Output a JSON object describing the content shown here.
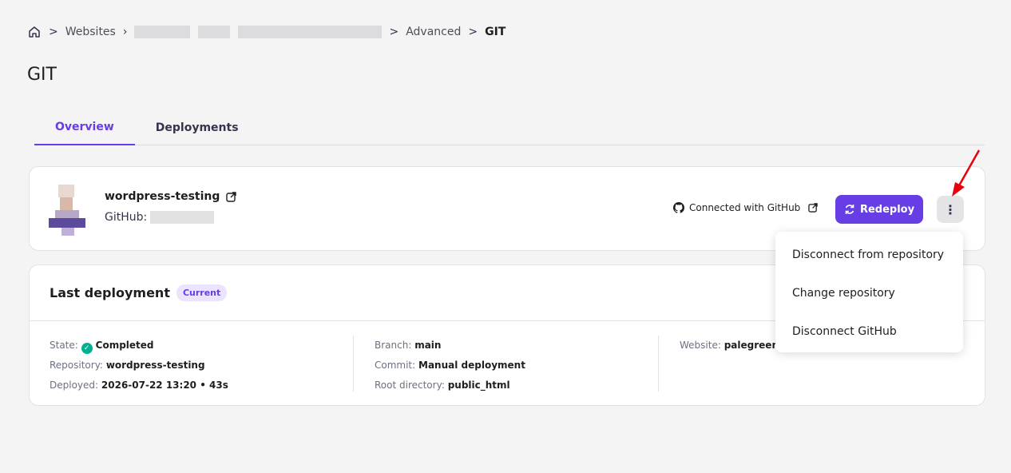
{
  "breadcrumb": {
    "home_icon": "home-icon",
    "websites": "Websites",
    "advanced": "Advanced",
    "current": "GIT"
  },
  "page": {
    "title": "GIT"
  },
  "tabs": [
    {
      "label": "Overview",
      "active": true
    },
    {
      "label": "Deployments",
      "active": false
    }
  ],
  "repo": {
    "name": "wordpress-testing",
    "github_prefix": "GitHub:",
    "connected_label": "Connected with GitHub",
    "redeploy_label": "Redeploy",
    "more_icon": "⋮"
  },
  "menu": {
    "items": [
      "Disconnect from repository",
      "Change repository",
      "Disconnect GitHub"
    ]
  },
  "deployment": {
    "title": "Last deployment",
    "badge": "Current",
    "state_label": "State:",
    "state_value": "Completed",
    "repository_label": "Repository:",
    "repository_value": "wordpress-testing",
    "deployed_label": "Deployed:",
    "deployed_value": "2026-07-22 13:20 • 43s",
    "branch_label": "Branch:",
    "branch_value": "main",
    "commit_label": "Commit:",
    "commit_value": "Manual deployment",
    "root_label": "Root directory:",
    "root_value": "public_html",
    "website_label": "Website:",
    "website_value": "palegreen"
  },
  "colors": {
    "accent": "#673de6",
    "success": "#00b090",
    "annotation": "#e8000b"
  }
}
